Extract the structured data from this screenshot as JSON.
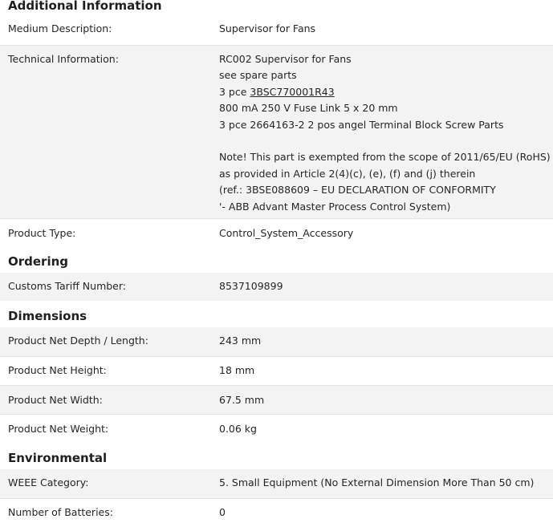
{
  "additional": {
    "title": "Additional Information",
    "medium_label": "Medium Description:",
    "medium_value": "Supervisor for Fans",
    "tech_label": "Technical Information:",
    "tech_lines": [
      "RC002 Supervisor for Fans",
      "see spare parts",
      "3 pce ",
      "3BSC770001R43",
      "800 mA 250 V Fuse Link 5 x 20 mm",
      "3 pce 2664163-2 2 pos angel Terminal Block Screw Parts",
      "Note! This part is exempted from the scope of 2011/65/EU (RoHS)",
      "as provided in Article 2(4)(c), (e), (f) and (j) therein",
      "(ref.: 3BSE088609 – EU DECLARATION OF CONFORMITY",
      "'- ABB Advant Master Process Control System)"
    ],
    "type_label": "Product Type:",
    "type_value": "Control_System_Accessory"
  },
  "ordering": {
    "title": "Ordering",
    "tariff_label": "Customs Tariff Number:",
    "tariff_value": "8537109899"
  },
  "dimensions": {
    "title": "Dimensions",
    "rows": [
      {
        "label": "Product Net Depth / Length:",
        "value": "243 mm"
      },
      {
        "label": "Product Net Height:",
        "value": "18 mm"
      },
      {
        "label": "Product Net Width:",
        "value": "67.5 mm"
      },
      {
        "label": "Product Net Weight:",
        "value": "0.06 kg"
      }
    ]
  },
  "environmental": {
    "title": "Environmental",
    "weee_label": "WEEE Category:",
    "weee_value": "5. Small Equipment (No External Dimension More Than 50 cm)",
    "batteries_label": "Number of Batteries:",
    "batteries_value": "0"
  }
}
